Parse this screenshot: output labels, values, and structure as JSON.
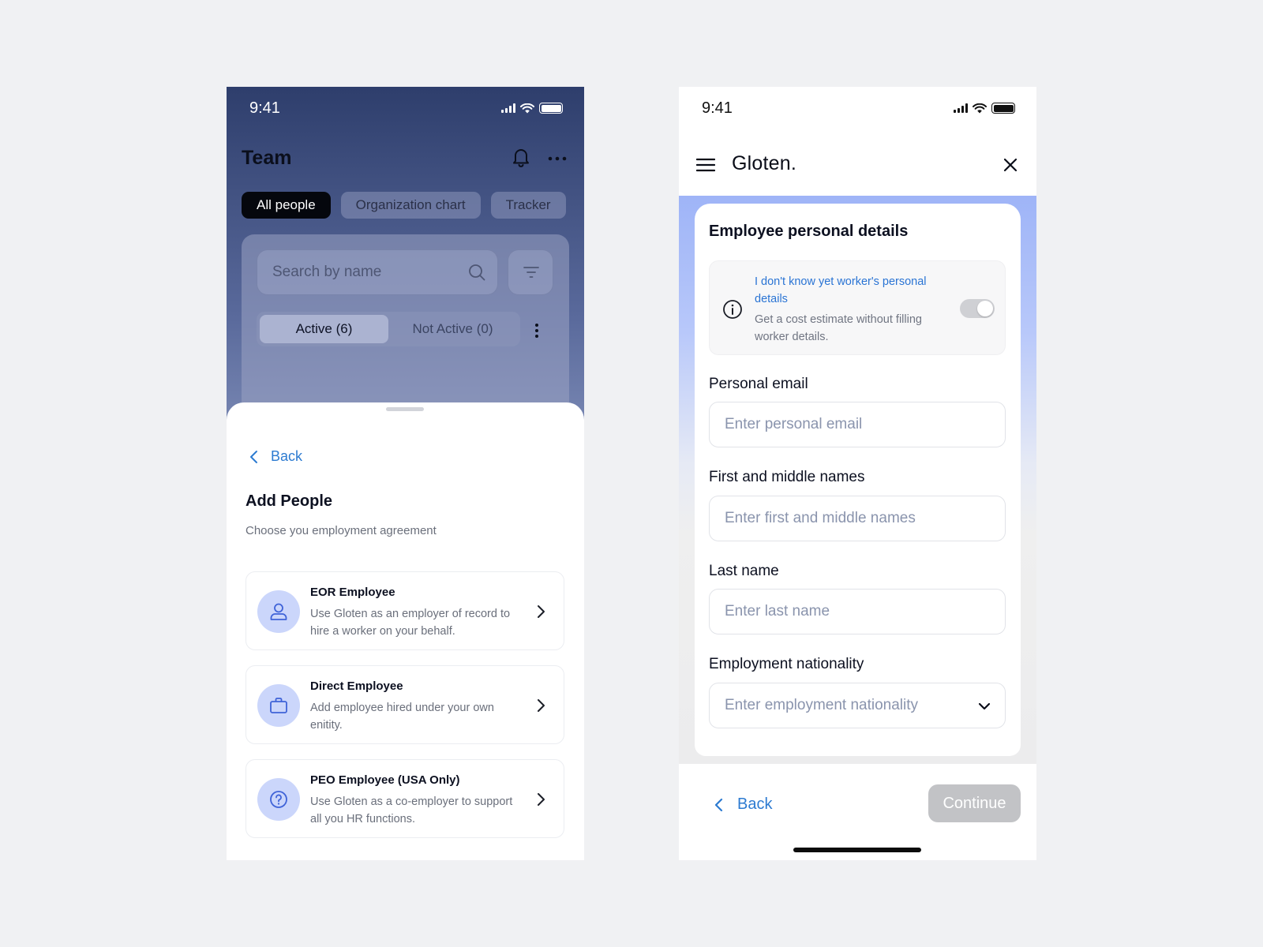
{
  "screen_a": {
    "status": {
      "time": "9:41"
    },
    "header": {
      "title": "Team"
    },
    "tabs": [
      {
        "label": "All people"
      },
      {
        "label": "Organization chart"
      },
      {
        "label": "Tracker"
      }
    ],
    "search": {
      "placeholder": "Search by name"
    },
    "segments": [
      {
        "label": "Active (6)"
      },
      {
        "label": "Not Active (0)"
      }
    ],
    "sheet": {
      "back_label": "Back",
      "title": "Add People",
      "subtitle": "Choose you employment agreement",
      "options": [
        {
          "title": "EOR Employee",
          "description": "Use Gloten as an employer of record to hire a worker on your behalf.",
          "icon": "user-icon"
        },
        {
          "title": "Direct Employee",
          "description": "Add employee hired under your own enitity.",
          "icon": "briefcase-icon"
        },
        {
          "title": "PEO Employee (USA Only)",
          "description": "Use Gloten as a co-employer to support all you HR functions.",
          "icon": "question-icon"
        }
      ]
    }
  },
  "screen_b": {
    "status": {
      "time": "9:41"
    },
    "header": {
      "brand": "Gloten."
    },
    "form": {
      "title": "Employee personal details",
      "info": {
        "title": "I don't know yet worker's personal details",
        "description": "Get a cost estimate without filling worker details."
      },
      "fields": [
        {
          "label": "Personal email",
          "placeholder": "Enter personal email",
          "value": ""
        },
        {
          "label": "First and middle names",
          "placeholder": "Enter first and middle names",
          "value": ""
        },
        {
          "label": "Last name",
          "placeholder": "Enter last name",
          "value": ""
        },
        {
          "label": "Employment nationality",
          "placeholder": "Enter employment nationality",
          "value": ""
        }
      ]
    },
    "footer": {
      "back_label": "Back",
      "continue_label": "Continue"
    }
  },
  "colors": {
    "accent_blue": "#2d7bd1",
    "icon_circle": "#cbd6fb",
    "icon_stroke": "#3f63d8",
    "disabled_button": "#c2c3c6"
  }
}
